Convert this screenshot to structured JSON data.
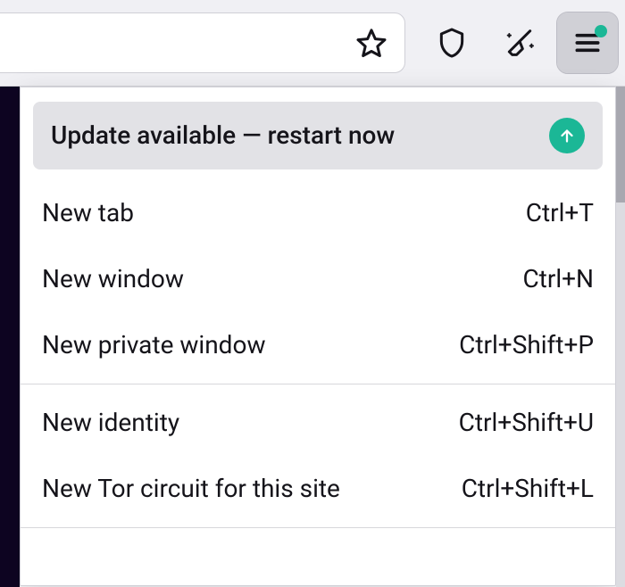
{
  "toolbar": {
    "star_icon": "star",
    "shield_icon": "shield",
    "sparkle_icon": "broom-sparkle",
    "menu_icon": "hamburger",
    "menu_has_update_dot": true
  },
  "menu": {
    "update": {
      "label": "Update available — restart now",
      "icon": "arrow-up-circle"
    },
    "sections": [
      {
        "items": [
          {
            "label": "New tab",
            "shortcut": "Ctrl+T"
          },
          {
            "label": "New window",
            "shortcut": "Ctrl+N"
          },
          {
            "label": "New private window",
            "shortcut": "Ctrl+Shift+P"
          }
        ]
      },
      {
        "items": [
          {
            "label": "New identity",
            "shortcut": "Ctrl+Shift+U"
          },
          {
            "label": "New Tor circuit for this site",
            "shortcut": "Ctrl+Shift+L"
          }
        ]
      }
    ]
  }
}
